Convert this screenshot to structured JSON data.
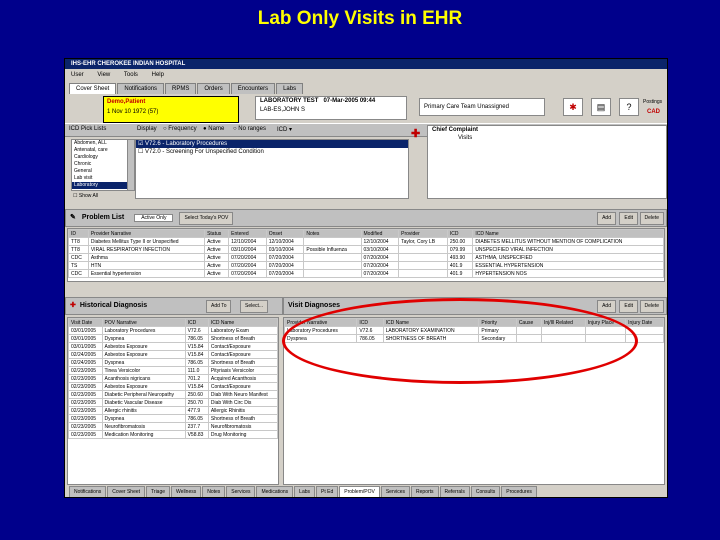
{
  "slide_title": "Lab Only Visits in EHR",
  "window": {
    "title": "IHS-EHR CHEROKEE INDIAN HOSPITAL",
    "menu": [
      "User",
      "View",
      "Tools",
      "Help"
    ],
    "tabs": [
      {
        "label": "Cover Sheet",
        "active": true
      },
      {
        "label": "Notifications",
        "active": false
      },
      {
        "label": "RPMS",
        "active": false
      },
      {
        "label": "Orders",
        "active": false
      },
      {
        "label": "Encounters",
        "active": false
      },
      {
        "label": "Labs",
        "active": false
      }
    ]
  },
  "patient": {
    "name": "Demo,Patient",
    "id": "1    Nov 10 1972 (57)",
    "lab_test": "LABORATORY TEST",
    "lab_date": "07-Mar-2005 09:44",
    "location": "LAB-ES,JOHN S",
    "primary_care": "Primary Care Team Unassigned",
    "postings_label": "Postings",
    "postings_value": "CAD"
  },
  "toolbar": {
    "pick_list_label": "ICD Pick Lists",
    "display_label": "Display",
    "filters": [
      "Frequency",
      "Name",
      "No ranges",
      "ICD"
    ],
    "chief_complaint_label": "Chief Complaint",
    "chief_complaint_sub": "Visits"
  },
  "pick_list": {
    "categories": [
      "Abdomen, ALL",
      "Antenatal, care",
      "Cardiology",
      "Chronic",
      "General",
      "Lab visit",
      "Laboratory"
    ],
    "selected_category": "Laboratory",
    "items": [
      {
        "label": "V72.6 - Laboratory Procedures",
        "checked": true,
        "selected": true
      },
      {
        "label": "V72.0 - Screening For Unspecified Condition",
        "checked": false,
        "selected": false
      }
    ],
    "show_all_label": "Show All"
  },
  "problem_list": {
    "title": "Problem List",
    "filter_value": "Active Only",
    "select_btn": "Select Today's POV",
    "add_btn": "Add",
    "edit_btn": "Edit",
    "delete_btn": "Delete",
    "columns": [
      "ID",
      "Provider Narrative",
      "Status",
      "Entered",
      "Onset",
      "Notes",
      "Modified",
      "Provider",
      "ICD",
      "ICD Name"
    ],
    "rows": [
      [
        "TT8",
        "Diabetes Mellitus Type II or Unspecified",
        "Active",
        "12/10/2004",
        "12/10/2004",
        "",
        "12/10/2004",
        "Taylor, Cory LB",
        "250.00",
        "DIABETES MELLITUS WITHOUT MENTION OF COMPLICATION"
      ],
      [
        "TT8",
        "VIRAL RESPIRATORY INFECTION",
        "Active",
        "03/10/2004",
        "03/10/2004",
        "Possible Influenza",
        "03/10/2004",
        "",
        "079.99",
        "UNSPECIFIED VIRAL INFECTION"
      ],
      [
        "CDC",
        "Asthma",
        "Active",
        "07/20/2004",
        "07/20/2004",
        "",
        "07/20/2004",
        "",
        "493.90",
        "ASTHMA, UNSPECIFIED"
      ],
      [
        "TS",
        "HTN",
        "Active",
        "07/20/2004",
        "07/20/2004",
        "",
        "07/20/2004",
        "",
        "401.9",
        "ESSENTIAL HYPERTENSION"
      ],
      [
        "CDC",
        "Essential hypertension",
        "Active",
        "07/20/2004",
        "07/20/2004",
        "",
        "07/20/2004",
        "",
        "401.9",
        "HYPERTENSION NOS"
      ]
    ]
  },
  "historical": {
    "title": "Historical Diagnosis",
    "add_btn": "Add To",
    "select_btn": "Select...",
    "columns": [
      "Visit Date",
      "POV Narrative",
      "ICD",
      "ICD Name"
    ],
    "rows": [
      [
        "03/01/2005",
        "Laboratory Procedures",
        "V72.6",
        "Laboratory Exam"
      ],
      [
        "03/01/2005",
        "Dyspnea",
        "786.05",
        "Shortness of Breath"
      ],
      [
        "03/01/2005",
        "Asbestos Exposure",
        "V15.84",
        "Contact/Exposure"
      ],
      [
        "02/24/2005",
        "Asbestos Exposure",
        "V15.84",
        "Contact/Exposure"
      ],
      [
        "02/24/2005",
        "Dyspnea",
        "786.05",
        "Shortness of Breath"
      ],
      [
        "02/23/2005",
        "Tinea Versicolor",
        "111.0",
        "Pityriasis Versicolor"
      ],
      [
        "02/23/2005",
        "Acanthosis nigricans",
        "701.2",
        "Acquired Acanthosis"
      ],
      [
        "02/23/2005",
        "Asbestos Exposure",
        "V15.84",
        "Contact/Exposure"
      ],
      [
        "02/23/2005",
        "Diabetic Peripheral Neuropathy",
        "250.60",
        "Diab With Neuro Manifest"
      ],
      [
        "02/23/2005",
        "Diabetic Vascular Disease",
        "250.70",
        "Diab With Circ Dis"
      ],
      [
        "02/23/2005",
        "Allergic rhinitis",
        "477.9",
        "Allergic Rhinitis"
      ],
      [
        "02/23/2005",
        "Dyspnea",
        "786.05",
        "Shortness of Breath"
      ],
      [
        "02/23/2005",
        "Neurofibromatosis",
        "237.7",
        "Neurofibromatosis"
      ],
      [
        "02/23/2005",
        "Medication Monitoring",
        "V58.83",
        "Drug Monitoring"
      ]
    ]
  },
  "visit_diagnoses": {
    "title": "Visit Diagnoses",
    "add_btn": "Add",
    "edit_btn": "Edit",
    "delete_btn": "Delete",
    "columns": [
      "Provider Narrative",
      "ICD",
      "ICD Name",
      "Priority",
      "Cause",
      "Inj/Ill Related",
      "Injury Place",
      "Injury Date"
    ],
    "rows": [
      [
        "Laboratory Procedures",
        "V72.6",
        "LABORATORY EXAMINATION",
        "Primary",
        "",
        "",
        "",
        ""
      ],
      [
        "Dyspnea",
        "786.05",
        "SHORTNESS OF BREATH",
        "Secondary",
        "",
        "",
        "",
        ""
      ]
    ]
  },
  "bottom_tabs": [
    {
      "label": "Notifications",
      "active": false
    },
    {
      "label": "Cover Sheet",
      "active": false
    },
    {
      "label": "Triage",
      "active": false
    },
    {
      "label": "Wellness",
      "active": false
    },
    {
      "label": "Notes",
      "active": false
    },
    {
      "label": "Services",
      "active": false
    },
    {
      "label": "Medications",
      "active": false
    },
    {
      "label": "Labs",
      "active": false
    },
    {
      "label": "Pt Ed",
      "active": false
    },
    {
      "label": "Problem/POV",
      "active": true
    },
    {
      "label": "Services",
      "active": false
    },
    {
      "label": "Reports",
      "active": false
    },
    {
      "label": "Referrals",
      "active": false
    },
    {
      "label": "Consults",
      "active": false
    },
    {
      "label": "Procedures",
      "active": false
    }
  ],
  "colors": {
    "background": "#00008B",
    "title": "#FFFF00",
    "highlight": "#E00000",
    "patient_bg": "#FFFF00"
  }
}
